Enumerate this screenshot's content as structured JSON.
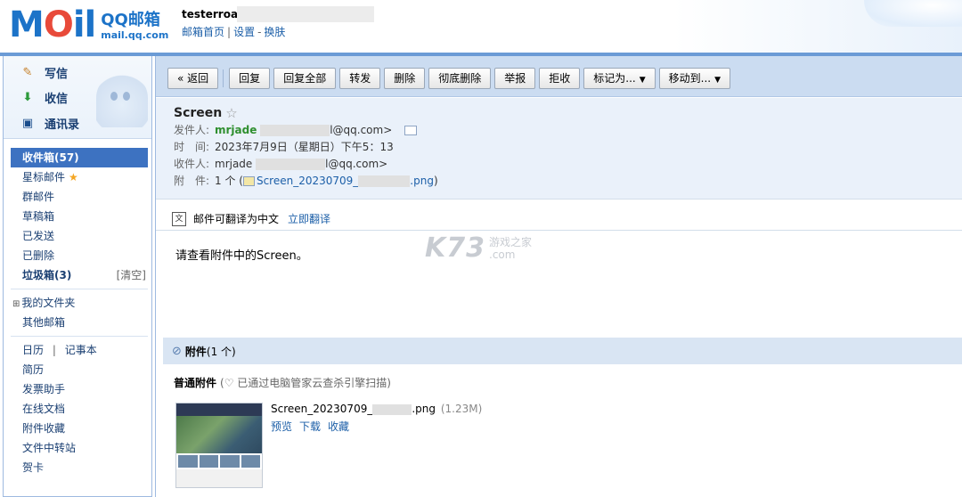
{
  "header": {
    "logo_text": "MAil",
    "logo_brand": "QQ邮箱",
    "logo_url": "mail.qq.com",
    "user": "testerroad·",
    "links": [
      "邮箱首页",
      "设置",
      "换肤"
    ]
  },
  "sidebar": {
    "compose": [
      {
        "label": "写信",
        "icon": "pencil-icon"
      },
      {
        "label": "收信",
        "icon": "inbox-download-icon"
      },
      {
        "label": "通讯录",
        "icon": "contact-card-icon"
      }
    ],
    "folders": {
      "inbox": "收件箱(57)",
      "starred": "星标邮件",
      "group": "群邮件",
      "drafts": "草稿箱",
      "sent": "已发送",
      "deleted": "已删除",
      "spam": "垃圾箱(3)",
      "spam_clean": "[清空]",
      "my_folders": "我的文件夹",
      "other_mailbox": "其他邮箱",
      "calendar": "日历",
      "notes": "记事本",
      "resume": "简历",
      "invoice": "发票助手",
      "online_docs": "在线文档",
      "attach_fav": "附件收藏",
      "file_transfer": "文件中转站",
      "cards": "贺卡"
    }
  },
  "toolbar": {
    "back": "« 返回",
    "reply": "回复",
    "reply_all": "回复全部",
    "forward": "转发",
    "delete": "删除",
    "delete_perm": "彻底删除",
    "report": "举报",
    "reject": "拒收",
    "mark_as": "标记为...",
    "move_to": "移动到..."
  },
  "message": {
    "subject": "Screen",
    "from_label": "发件人:",
    "from_name": "mrjade",
    "from_domain": "l@qq.com>",
    "time_label": "时　间:",
    "time": "2023年7月9日（星期日）下午5：13",
    "to_label": "收件人:",
    "to_name": "mrjade",
    "to_domain": "l@qq.com>",
    "attach_label": "附　件:",
    "attach_count": "1 个 (",
    "attach_file_a": "Screen_20230709_",
    "attach_file_b": ".png",
    "attach_close": ")",
    "translate_text": "邮件可翻译为中文",
    "translate_link": "立即翻译",
    "body": "请查看附件中的Screen。",
    "watermark_main": "K73",
    "watermark_cn": "游戏之家",
    "watermark_com": ".com"
  },
  "attachments": {
    "title": "附件",
    "count": "(1 个)",
    "normal_label": "普通附件",
    "scan_note": "(♡ 已通过电脑管家云查杀引擎扫描)",
    "file_name_a": "Screen_20230709_",
    "file_name_b": ".png",
    "file_size": "(1.23M)",
    "actions": [
      "预览",
      "下载",
      "收藏"
    ]
  }
}
